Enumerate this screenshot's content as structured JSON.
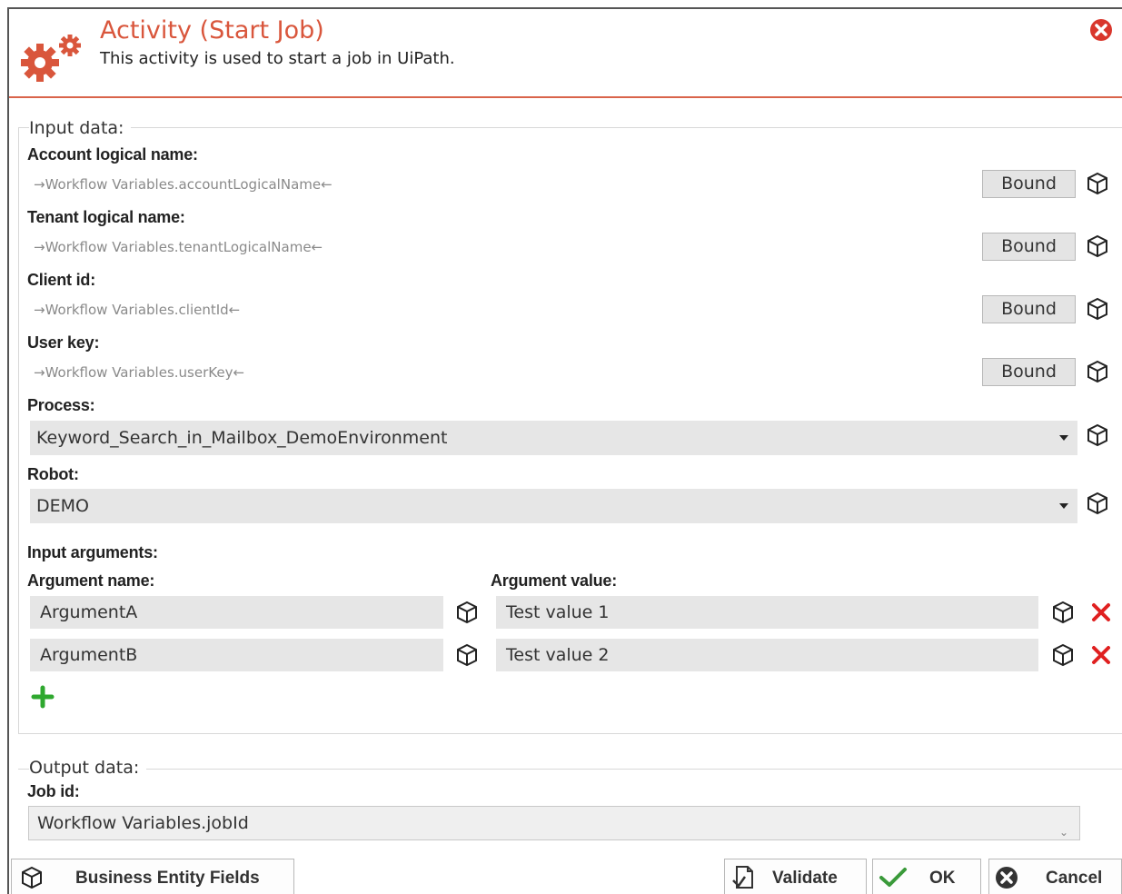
{
  "header": {
    "title": "Activity (Start Job)",
    "subtitle": "This activity is used to start a job in UiPath.",
    "accent_color": "#d9563c",
    "icon": "gears-icon",
    "close_icon": "close-circle-icon"
  },
  "input_data": {
    "legend": "Input data:",
    "fields": [
      {
        "label": "Account logical name:",
        "binding": "→Workflow Variables.accountLogicalName←",
        "button": "Bound"
      },
      {
        "label": "Tenant logical name:",
        "binding": "→Workflow Variables.tenantLogicalName←",
        "button": "Bound"
      },
      {
        "label": "Client id:",
        "binding": "→Workflow Variables.clientId←",
        "button": "Bound"
      },
      {
        "label": "User key:",
        "binding": "→Workflow Variables.userKey←",
        "button": "Bound"
      }
    ],
    "process": {
      "label": "Process:",
      "value": "Keyword_Search_in_Mailbox_DemoEnvironment"
    },
    "robot": {
      "label": "Robot:",
      "value": "DEMO"
    },
    "arguments": {
      "label": "Input arguments:",
      "name_header": "Argument name:",
      "value_header": "Argument value:",
      "rows": [
        {
          "name": "ArgumentA",
          "value": "Test value 1"
        },
        {
          "name": "ArgumentB",
          "value": "Test value 2"
        }
      ],
      "add_icon": "plus-icon",
      "delete_icon": "delete-x-icon"
    }
  },
  "output_data": {
    "legend": "Output data:",
    "job_id_label": "Job id:",
    "job_id_value": "Workflow Variables.jobId"
  },
  "footer": {
    "business_entity_fields": "Business Entity Fields",
    "validate": "Validate",
    "ok": "OK",
    "cancel": "Cancel"
  }
}
